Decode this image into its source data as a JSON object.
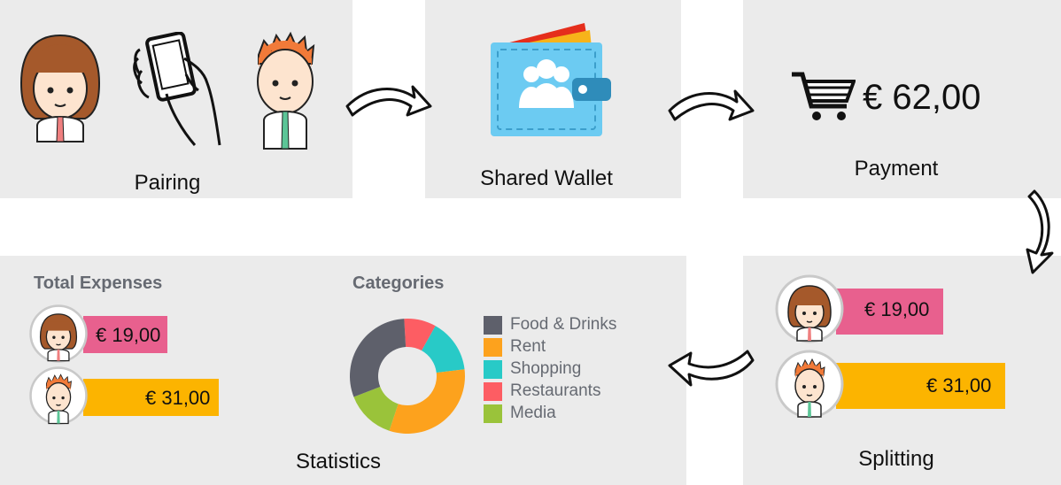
{
  "steps": {
    "pairing": "Pairing",
    "shared_wallet": "Shared Wallet",
    "payment": "Payment",
    "splitting": "Splitting",
    "statistics": "Statistics"
  },
  "payment": {
    "amount": "€ 62,00",
    "icon": "shopping-cart-icon"
  },
  "wallet": {
    "icon": "group-icon"
  },
  "splitting": {
    "person1_amount": "€ 19,00",
    "person2_amount": "€ 31,00"
  },
  "statistics": {
    "total_title": "Total Expenses",
    "categories_title": "Categories",
    "person1_amount": "€ 19,00",
    "person2_amount": "€ 31,00"
  },
  "colors": {
    "panel": "#ebebeb",
    "pink": "#e8608e",
    "yellow": "#fcb400",
    "wallet": "#6ccbf2"
  },
  "chart_data": {
    "type": "pie",
    "title": "Categories",
    "categories": [
      "Food & Drinks",
      "Rent",
      "Shopping",
      "Restaurants",
      "Media"
    ],
    "values": [
      30,
      32,
      15,
      9,
      14
    ],
    "colors": [
      "#5e606b",
      "#fda21d",
      "#28cac7",
      "#fd5d63",
      "#9ac33a"
    ],
    "legend": "right"
  }
}
